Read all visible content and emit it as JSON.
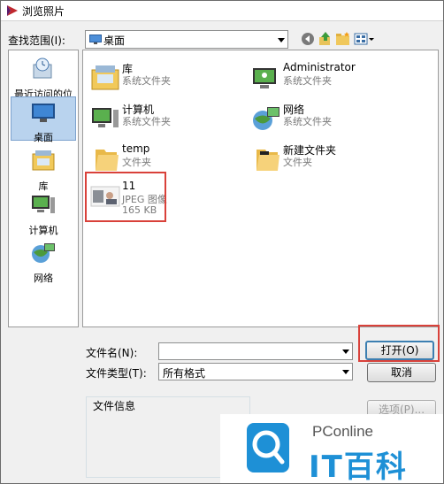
{
  "window": {
    "title": "浏览照片"
  },
  "lookin": {
    "label": "查找范围(I):",
    "value": "桌面"
  },
  "places": [
    {
      "label": "最近访问的位置",
      "icon": "recent-places-icon"
    },
    {
      "label": "桌面",
      "icon": "desktop-icon",
      "selected": true
    },
    {
      "label": "库",
      "icon": "libraries-icon"
    },
    {
      "label": "计算机",
      "icon": "computer-icon"
    },
    {
      "label": "网络",
      "icon": "network-icon"
    }
  ],
  "files": [
    {
      "name": "库",
      "type": "系统文件夹",
      "icon": "libraries-icon"
    },
    {
      "name": "Administrator",
      "type": "系统文件夹",
      "icon": "user-folder-icon"
    },
    {
      "name": "计算机",
      "type": "系统文件夹",
      "icon": "computer-icon"
    },
    {
      "name": "网络",
      "type": "系统文件夹",
      "icon": "network-icon"
    },
    {
      "name": "temp",
      "type": "文件夹",
      "icon": "folder-icon"
    },
    {
      "name": "新建文件夹",
      "type": "文件夹",
      "icon": "folder-icon"
    },
    {
      "name": "11",
      "type": "JPEG 图像",
      "size": "165 KB",
      "icon": "jpeg-thumbnail-icon"
    }
  ],
  "filename": {
    "label": "文件名(N):",
    "value": ""
  },
  "filetype": {
    "label": "文件类型(T):",
    "value": "所有格式"
  },
  "buttons": {
    "open": "打开(O)",
    "cancel": "取消",
    "options": "选项(P)..."
  },
  "fileinfo": {
    "label": "文件信息"
  },
  "watermark": {
    "brand": "PConline",
    "name": "IT百科"
  },
  "colors": {
    "highlight": "#d9413a",
    "selection": "#b9d3ee",
    "brand_blue": "#1e90d6"
  }
}
